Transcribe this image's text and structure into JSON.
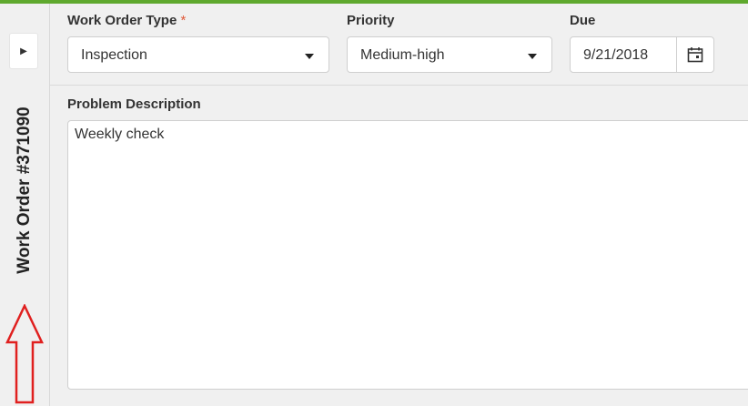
{
  "sidebar": {
    "expand_icon": "caret-right-icon",
    "title": "Work Order #371090",
    "annotation_icon": "outline-up-arrow-icon",
    "annotation_color": "#e0201f"
  },
  "form": {
    "work_order_type": {
      "label": "Work Order Type",
      "required_marker": "*",
      "value": "Inspection"
    },
    "priority": {
      "label": "Priority",
      "value": "Medium-high"
    },
    "due": {
      "label": "Due",
      "value": "9/21/2018",
      "icon": "calendar-icon"
    },
    "problem_description": {
      "label": "Problem Description",
      "value": "Weekly check"
    }
  },
  "colors": {
    "accent": "#5fa92e",
    "required": "#e05a3a"
  }
}
